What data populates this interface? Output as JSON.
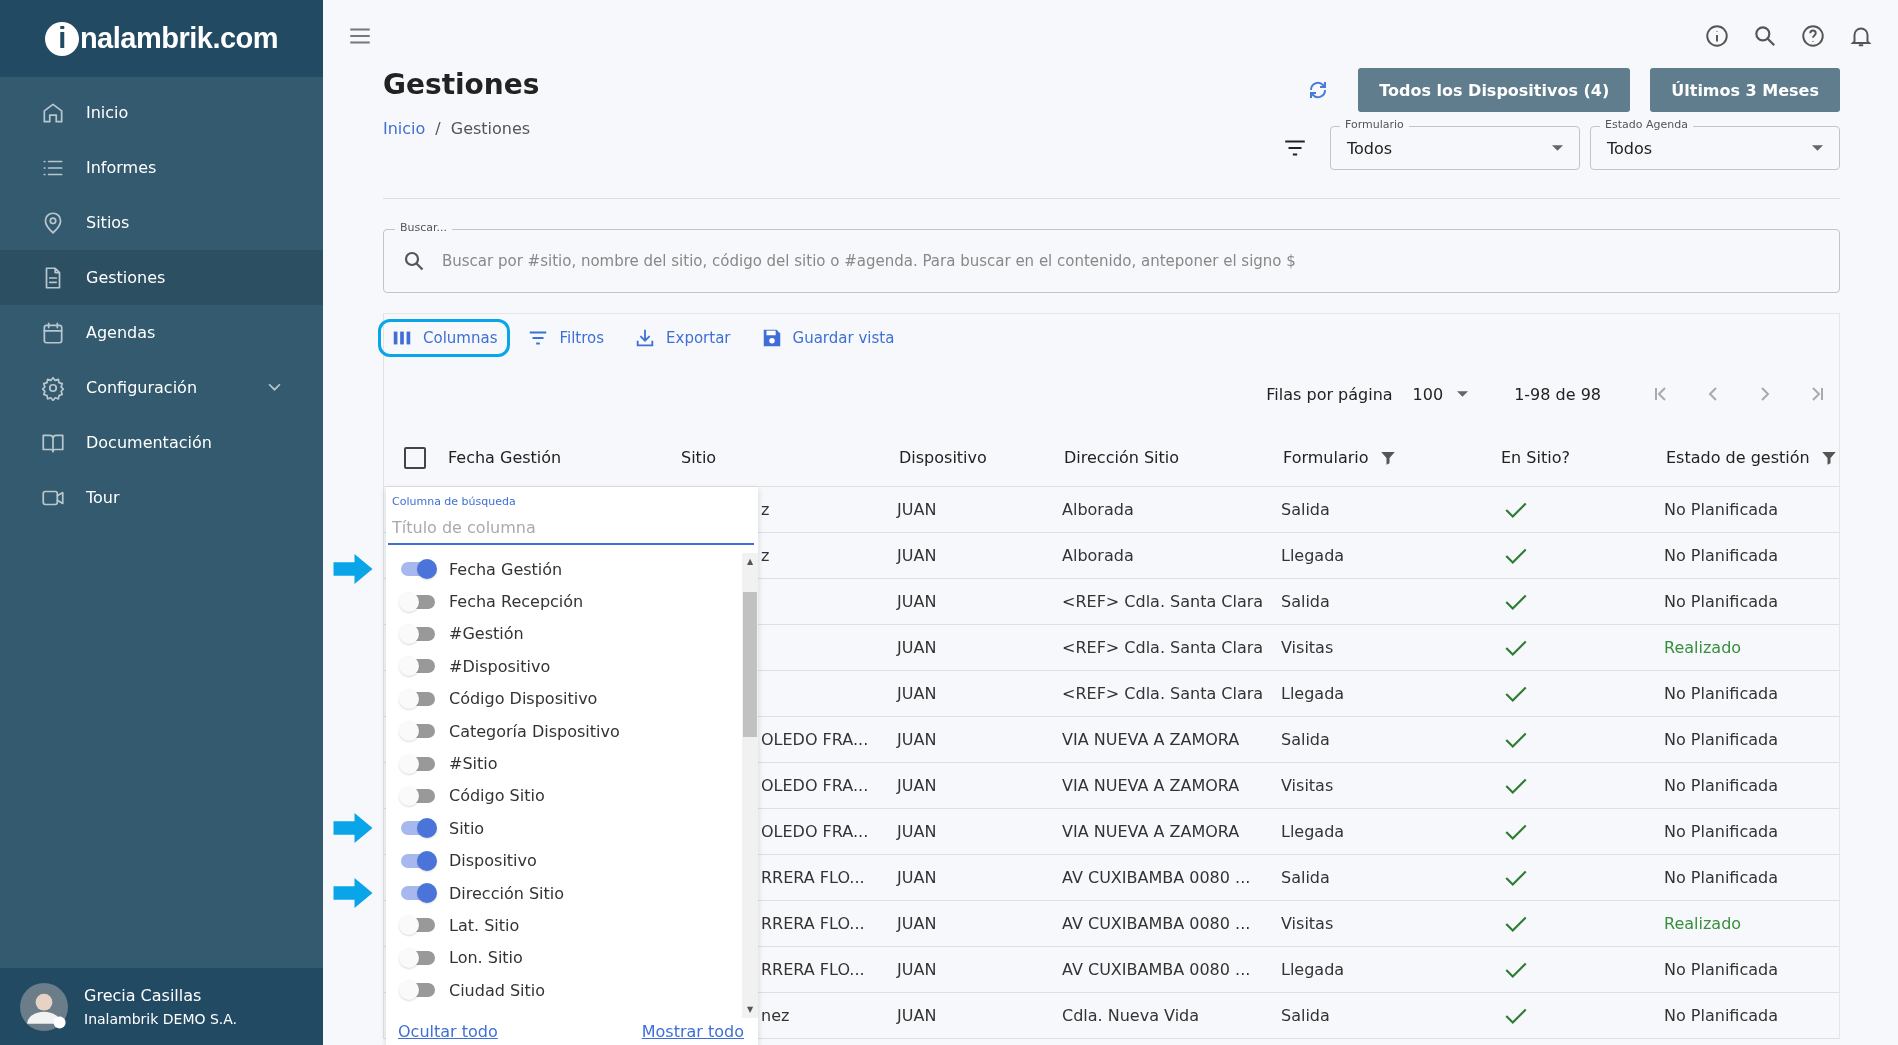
{
  "sidebar": {
    "logo": {
      "mark": "i",
      "text": "nalambrik.com"
    },
    "items": [
      {
        "label": "Inicio",
        "selected": false
      },
      {
        "label": "Informes",
        "selected": false
      },
      {
        "label": "Sitios",
        "selected": false
      },
      {
        "label": "Gestiones",
        "selected": true
      },
      {
        "label": "Agendas",
        "selected": false
      },
      {
        "label": "Configuración",
        "selected": false,
        "expandable": true
      },
      {
        "label": "Documentación",
        "selected": false
      },
      {
        "label": "Tour",
        "selected": false
      }
    ],
    "user": {
      "name": "Grecia Casillas",
      "company": "Inalambrik DEMO S.A."
    }
  },
  "page": {
    "title": "Gestiones",
    "breadcrumb_separator": "/",
    "breadcrumb": [
      {
        "label": "Inicio",
        "kind": "link"
      },
      {
        "label": "Gestiones",
        "kind": "current"
      }
    ],
    "buttons": [
      "Todos los Dispositivos (4)",
      "Últimos 3 Meses"
    ],
    "filters": [
      {
        "label": "Formulario",
        "value": "Todos"
      },
      {
        "label": "Estado Agenda",
        "value": "Todos"
      }
    ]
  },
  "search": {
    "label": "Buscar...",
    "placeholder": "Buscar por #sitio, nombre del sitio, código del sitio o #agenda. Para buscar en el contenido, anteponer el signo $"
  },
  "toolbar": [
    {
      "label": "Columnas",
      "highlighted": true
    },
    {
      "label": "Filtros",
      "highlighted": false
    },
    {
      "label": "Exportar",
      "highlighted": false
    },
    {
      "label": "Guardar vista",
      "highlighted": false
    }
  ],
  "pagination": {
    "rows_label": "Filas por página",
    "rows_value": "100",
    "range": "1-98 de 98"
  },
  "table": {
    "select_all_checked": false,
    "columns": [
      {
        "label": "Fecha Gestión",
        "filter": false
      },
      {
        "label": "Sitio",
        "filter": false
      },
      {
        "label": "Dispositivo",
        "filter": false
      },
      {
        "label": "Dirección Sitio",
        "filter": false
      },
      {
        "label": "Formulario",
        "filter": true
      },
      {
        "label": "En Sitio?",
        "filter": false
      },
      {
        "label": "Estado de gestión",
        "filter": true
      }
    ],
    "rows": [
      {
        "sitio": "z",
        "dispositivo": "JUAN",
        "direccion": "Alborada",
        "formulario": "Salida",
        "en_sitio": true,
        "estado": "No Planificada",
        "done": false
      },
      {
        "sitio": "z",
        "dispositivo": "JUAN",
        "direccion": "Alborada",
        "formulario": "Llegada",
        "en_sitio": true,
        "estado": "No Planificada",
        "done": false
      },
      {
        "dispositivo": "JUAN",
        "direccion": "<REF> Cdla. Santa Clara",
        "formulario": "Salida",
        "en_sitio": true,
        "estado": "No Planificada",
        "done": false
      },
      {
        "dispositivo": "JUAN",
        "direccion": "<REF> Cdla. Santa Clara",
        "formulario": "Visitas",
        "en_sitio": true,
        "estado": "Realizado",
        "done": true
      },
      {
        "dispositivo": "JUAN",
        "direccion": "<REF> Cdla. Santa Clara",
        "formulario": "Llegada",
        "en_sitio": true,
        "estado": "No Planificada",
        "done": false
      },
      {
        "sitio": "OLEDO FRA...",
        "dispositivo": "JUAN",
        "direccion": "VIA NUEVA A ZAMORA",
        "formulario": "Salida",
        "en_sitio": true,
        "estado": "No Planificada",
        "done": false
      },
      {
        "sitio": "OLEDO FRA...",
        "dispositivo": "JUAN",
        "direccion": "VIA NUEVA A ZAMORA",
        "formulario": "Visitas",
        "en_sitio": true,
        "estado": "No Planificada",
        "done": false
      },
      {
        "sitio": "OLEDO FRA...",
        "dispositivo": "JUAN",
        "direccion": "VIA NUEVA A ZAMORA",
        "formulario": "Llegada",
        "en_sitio": true,
        "estado": "No Planificada",
        "done": false
      },
      {
        "sitio": "RRERA FLO...",
        "dispositivo": "JUAN",
        "direccion": "AV CUXIBAMBA 0080 ...",
        "formulario": "Salida",
        "en_sitio": true,
        "estado": "No Planificada",
        "done": false
      },
      {
        "sitio": "RRERA FLO...",
        "dispositivo": "JUAN",
        "direccion": "AV CUXIBAMBA 0080 ...",
        "formulario": "Visitas",
        "en_sitio": true,
        "estado": "Realizado",
        "done": true
      },
      {
        "sitio": "RRERA FLO...",
        "dispositivo": "JUAN",
        "direccion": "AV CUXIBAMBA 0080 ...",
        "formulario": "Llegada",
        "en_sitio": true,
        "estado": "No Planificada",
        "done": false
      },
      {
        "sitio": "nez",
        "dispositivo": "JUAN",
        "direccion": "Cdla. Nueva Vida",
        "formulario": "Salida",
        "en_sitio": true,
        "estado": "No Planificada",
        "done": false
      }
    ]
  },
  "column_picker": {
    "label": "Columna de búsqueda",
    "placeholder": "Título de columna",
    "items": [
      {
        "label": "Fecha Gestión",
        "on": true,
        "pointed": true
      },
      {
        "label": "Fecha Recepción",
        "on": false,
        "pointed": false
      },
      {
        "label": "#Gestión",
        "on": false,
        "pointed": false
      },
      {
        "label": "#Dispositivo",
        "on": false,
        "pointed": false
      },
      {
        "label": "Código Dispositivo",
        "on": false,
        "pointed": false
      },
      {
        "label": "Categoría Dispositivo",
        "on": false,
        "pointed": false
      },
      {
        "label": "#Sitio",
        "on": false,
        "pointed": false
      },
      {
        "label": "Código Sitio",
        "on": false,
        "pointed": false
      },
      {
        "label": "Sitio",
        "on": true,
        "pointed": true
      },
      {
        "label": "Dispositivo",
        "on": true,
        "pointed": false
      },
      {
        "label": "Dirección Sitio",
        "on": true,
        "pointed": true
      },
      {
        "label": "Lat. Sitio",
        "on": false,
        "pointed": false
      },
      {
        "label": "Lon. Sitio",
        "on": false,
        "pointed": false
      },
      {
        "label": "Ciudad Sitio",
        "on": false,
        "pointed": false
      }
    ],
    "scroll_up": "▲",
    "scroll_down": "▼",
    "hide_all": "Ocultar todo",
    "show_all": "Mostrar todo"
  }
}
